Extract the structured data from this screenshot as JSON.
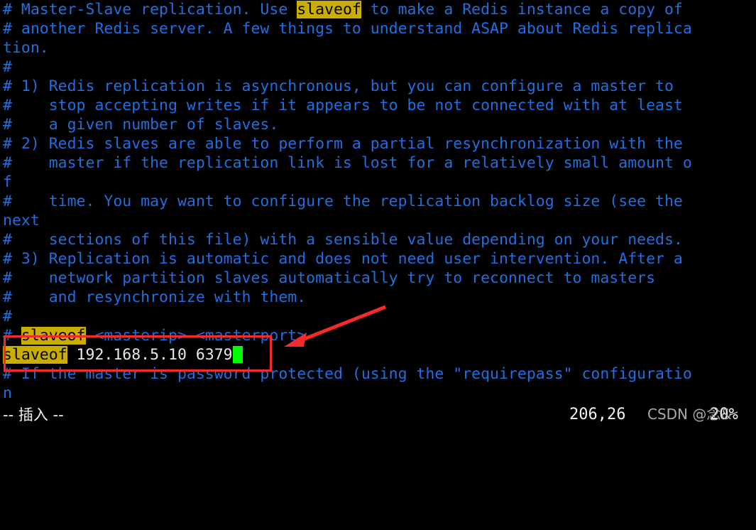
{
  "terminal": {
    "background_color": "#000000",
    "comment_color": "#1f6fe0",
    "value_color": "#e8e8e8",
    "search_highlight_bg": "#c9ae00",
    "search_highlight_fg": "#000000",
    "cursor_color": "#00ff00",
    "lines": [
      [
        {
          "text": "# Master-Slave replication. Use ",
          "style": "comment"
        },
        {
          "text": "slaveof",
          "style": "highlight"
        },
        {
          "text": " to make a Redis instance a copy of",
          "style": "comment"
        }
      ],
      [
        {
          "text": "# another Redis server. A few things to understand ASAP about Redis replica",
          "style": "comment"
        }
      ],
      [
        {
          "text": "tion.",
          "style": "comment"
        }
      ],
      [
        {
          "text": "#",
          "style": "comment"
        }
      ],
      [
        {
          "text": "# 1) Redis replication is asynchronous, but you can configure a master to",
          "style": "comment"
        }
      ],
      [
        {
          "text": "#    stop accepting writes if it appears to be not connected with at least",
          "style": "comment"
        }
      ],
      [
        {
          "text": "#    a given number of slaves.",
          "style": "comment"
        }
      ],
      [
        {
          "text": "# 2) Redis slaves are able to perform a partial resynchronization with the",
          "style": "comment"
        }
      ],
      [
        {
          "text": "#    master if the replication link is lost for a relatively small amount o",
          "style": "comment"
        }
      ],
      [
        {
          "text": "f",
          "style": "comment"
        }
      ],
      [
        {
          "text": "#    time. You may want to configure the replication backlog size (see the",
          "style": "comment"
        }
      ],
      [
        {
          "text": "next",
          "style": "comment"
        }
      ],
      [
        {
          "text": "#    sections of this file) with a sensible value depending on your needs.",
          "style": "comment"
        }
      ],
      [
        {
          "text": "# 3) Replication is automatic and does not need user intervention. After a",
          "style": "comment"
        }
      ],
      [
        {
          "text": "#    network partition slaves automatically try to reconnect to masters",
          "style": "comment"
        }
      ],
      [
        {
          "text": "#    and resynchronize with them.",
          "style": "comment"
        }
      ],
      [
        {
          "text": "#",
          "style": "comment"
        }
      ],
      [
        {
          "text": "# ",
          "style": "comment"
        },
        {
          "text": "slaveof",
          "style": "highlight"
        },
        {
          "text": " <masterip> <masterport>",
          "style": "comment"
        }
      ],
      [
        {
          "text": "slaveof",
          "style": "highlight"
        },
        {
          "text": " 192.168.5.10 6379",
          "style": "value"
        },
        {
          "text": "",
          "style": "cursor"
        }
      ],
      [
        {
          "text": "# If the master is password protected (using the \"requirepass\" configuratio",
          "style": "comment"
        }
      ],
      [
        {
          "text": "n",
          "style": "comment"
        }
      ]
    ]
  },
  "statusbar": {
    "mode": "-- 插入 --",
    "position": "206,26",
    "percent": "20%"
  },
  "watermark": {
    "text": "CSDN @念&"
  },
  "annotations": {
    "rectangle": {
      "color": "#f42b2b",
      "label": "slaveof-config-highlight-box"
    },
    "arrow": {
      "color": "#f42b2b",
      "label": "pointer-arrow-to-slaveof-line"
    }
  }
}
